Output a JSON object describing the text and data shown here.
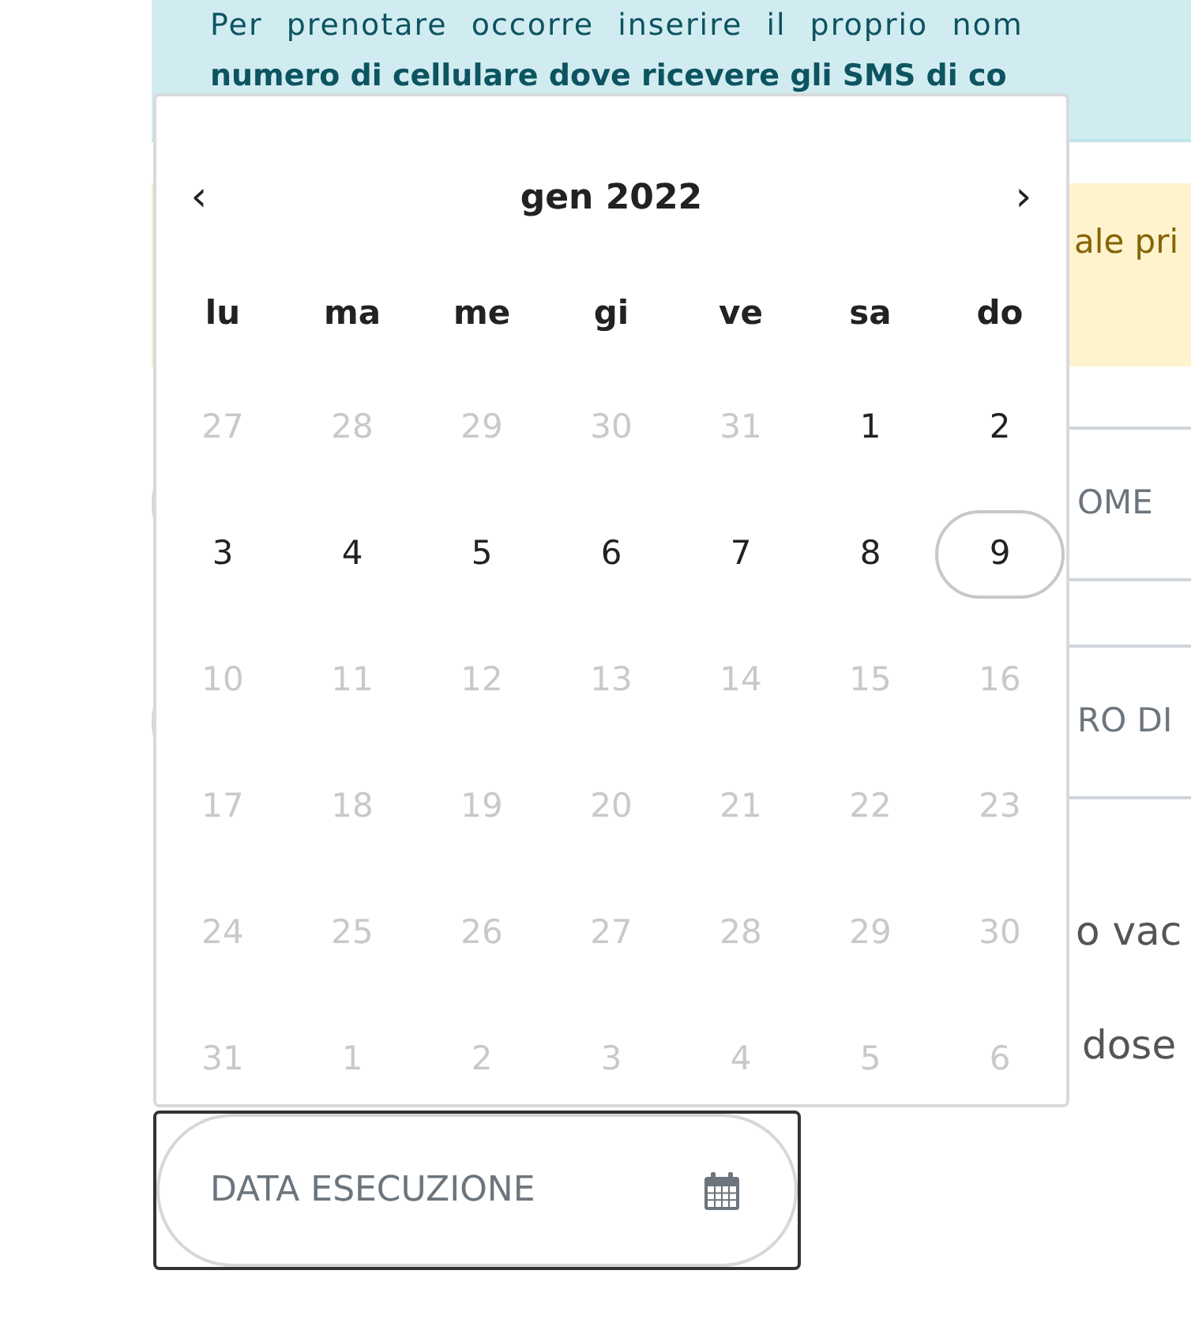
{
  "info_box": {
    "line_1": "Per prenotare occorre inserire il proprio nom",
    "line_2": "numero di cellulare dove ricevere gli SMS di co"
  },
  "warning_box": {
    "text": "ale pri"
  },
  "fields": [
    {
      "label": "OME"
    },
    {
      "label": "RO DI"
    }
  ],
  "heading": {
    "line_1": "o vac",
    "line_2": "dose"
  },
  "date_field": {
    "placeholder": "DATA ESECUZIONE"
  },
  "calendar": {
    "prev": "‹",
    "next": "›",
    "month": "gen 2022",
    "weekdays": [
      "lu",
      "ma",
      "me",
      "gi",
      "ve",
      "sa",
      "do"
    ],
    "days": [
      {
        "label": "27",
        "disabled": true,
        "selected": false
      },
      {
        "label": "28",
        "disabled": true,
        "selected": false
      },
      {
        "label": "29",
        "disabled": true,
        "selected": false
      },
      {
        "label": "30",
        "disabled": true,
        "selected": false
      },
      {
        "label": "31",
        "disabled": true,
        "selected": false
      },
      {
        "label": "1",
        "disabled": false,
        "selected": false
      },
      {
        "label": "2",
        "disabled": false,
        "selected": false
      },
      {
        "label": "3",
        "disabled": false,
        "selected": false
      },
      {
        "label": "4",
        "disabled": false,
        "selected": false
      },
      {
        "label": "5",
        "disabled": false,
        "selected": false
      },
      {
        "label": "6",
        "disabled": false,
        "selected": false
      },
      {
        "label": "7",
        "disabled": false,
        "selected": false
      },
      {
        "label": "8",
        "disabled": false,
        "selected": false
      },
      {
        "label": "9",
        "disabled": false,
        "selected": true
      },
      {
        "label": "10",
        "disabled": true,
        "selected": false
      },
      {
        "label": "11",
        "disabled": true,
        "selected": false
      },
      {
        "label": "12",
        "disabled": true,
        "selected": false
      },
      {
        "label": "13",
        "disabled": true,
        "selected": false
      },
      {
        "label": "14",
        "disabled": true,
        "selected": false
      },
      {
        "label": "15",
        "disabled": true,
        "selected": false
      },
      {
        "label": "16",
        "disabled": true,
        "selected": false
      },
      {
        "label": "17",
        "disabled": true,
        "selected": false
      },
      {
        "label": "18",
        "disabled": true,
        "selected": false
      },
      {
        "label": "19",
        "disabled": true,
        "selected": false
      },
      {
        "label": "20",
        "disabled": true,
        "selected": false
      },
      {
        "label": "21",
        "disabled": true,
        "selected": false
      },
      {
        "label": "22",
        "disabled": true,
        "selected": false
      },
      {
        "label": "23",
        "disabled": true,
        "selected": false
      },
      {
        "label": "24",
        "disabled": true,
        "selected": false
      },
      {
        "label": "25",
        "disabled": true,
        "selected": false
      },
      {
        "label": "26",
        "disabled": true,
        "selected": false
      },
      {
        "label": "27",
        "disabled": true,
        "selected": false
      },
      {
        "label": "28",
        "disabled": true,
        "selected": false
      },
      {
        "label": "29",
        "disabled": true,
        "selected": false
      },
      {
        "label": "30",
        "disabled": true,
        "selected": false
      },
      {
        "label": "31",
        "disabled": true,
        "selected": false
      },
      {
        "label": "1",
        "disabled": true,
        "selected": false
      },
      {
        "label": "2",
        "disabled": true,
        "selected": false
      },
      {
        "label": "3",
        "disabled": true,
        "selected": false
      },
      {
        "label": "4",
        "disabled": true,
        "selected": false
      },
      {
        "label": "5",
        "disabled": true,
        "selected": false
      },
      {
        "label": "6",
        "disabled": true,
        "selected": false
      }
    ]
  }
}
